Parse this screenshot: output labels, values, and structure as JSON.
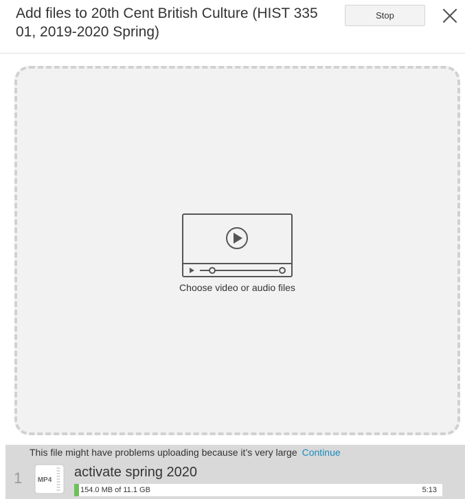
{
  "header": {
    "title": "Add files to 20th Cent British Culture (HIST 335 01, 2019-2020 Spring)",
    "stop_label": "Stop",
    "close_icon": "close-icon"
  },
  "dropzone": {
    "icon": "video-player-icon",
    "label": "Choose video or audio files"
  },
  "upload": {
    "warning": "This file might have problems uploading because it’s very large",
    "continue_label": "Continue",
    "items": [
      {
        "index": "1",
        "type_badge": "MP4",
        "name": "activate spring 2020",
        "progress_text": "154.0 MB of 11.1 GB",
        "progress_fraction": 0.0139,
        "time_remaining": "5:13"
      }
    ]
  },
  "colors": {
    "progress": "#6fbf5b",
    "link": "#1a8bbf",
    "panel": "#d9d9d9",
    "dropzone": "#f2f2f2",
    "dropzone_border": "#d1d1d1"
  }
}
